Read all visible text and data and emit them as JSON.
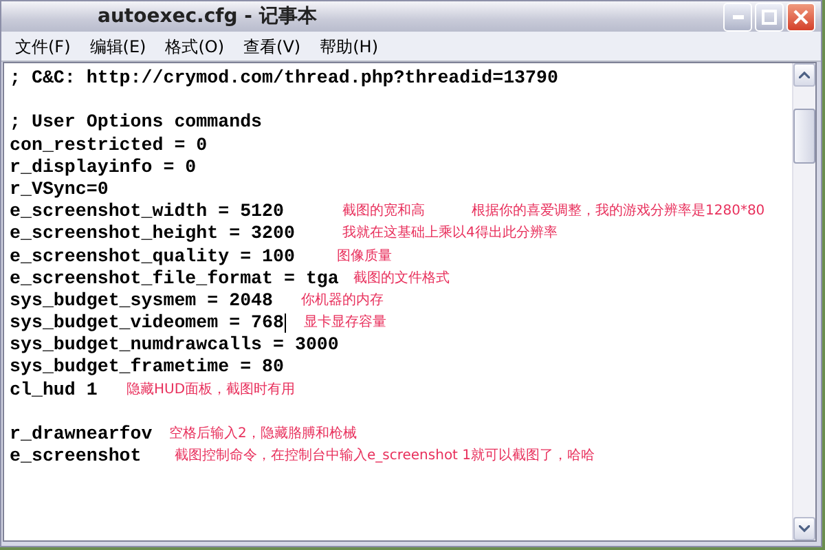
{
  "window": {
    "title": "autoexec.cfg - 记事本"
  },
  "menu": [
    "文件(F)",
    "编辑(E)",
    "格式(O)",
    "查看(V)",
    "帮助(H)"
  ],
  "lines": [
    {
      "kind": "code",
      "text": "; C&C: http://crymod.com/thread.php?threadid=13790"
    },
    {
      "kind": "blank"
    },
    {
      "kind": "code",
      "text": "; User Options commands"
    },
    {
      "kind": "code",
      "text": "con_restricted = 0"
    },
    {
      "kind": "code",
      "text": "r_displayinfo = 0"
    },
    {
      "kind": "code",
      "text": "r_VSync=0"
    },
    {
      "kind": "code",
      "text": "e_screenshot_width = 5120",
      "notes": [
        "截图的宽和高",
        "根据你的喜爱调整，我的游戏分辨率是1280*80"
      ]
    },
    {
      "kind": "code",
      "text": "e_screenshot_height = 3200",
      "notes": [
        "我就在这基础上乘以4得出此分辨率"
      ]
    },
    {
      "kind": "code",
      "text": "e_screenshot_quality = 100",
      "notes": [
        "图像质量"
      ]
    },
    {
      "kind": "code",
      "text": "e_screenshot_file_format = tga",
      "notes": [
        "截图的文件格式"
      ]
    },
    {
      "kind": "code",
      "text": "sys_budget_sysmem = 2048",
      "notes": [
        "你机器的内存"
      ]
    },
    {
      "kind": "code",
      "text": "sys_budget_videomem = 768",
      "cursor": true,
      "notes": [
        "显卡显存容量"
      ]
    },
    {
      "kind": "code",
      "text": "sys_budget_numdrawcalls = 3000"
    },
    {
      "kind": "code",
      "text": "sys_budget_frametime = 80"
    },
    {
      "kind": "code",
      "text": "cl_hud 1",
      "notes": [
        "隐藏HUD面板，截图时有用"
      ]
    },
    {
      "kind": "blank"
    },
    {
      "kind": "code",
      "text": "r_drawnearfov",
      "notes": [
        "空格后输入2，隐藏胳膊和枪械"
      ]
    },
    {
      "kind": "code",
      "text": "e_screenshot",
      "notes": [
        "截图控制命令，在控制台中输入e_screenshot 1就可以截图了，哈哈"
      ]
    }
  ]
}
